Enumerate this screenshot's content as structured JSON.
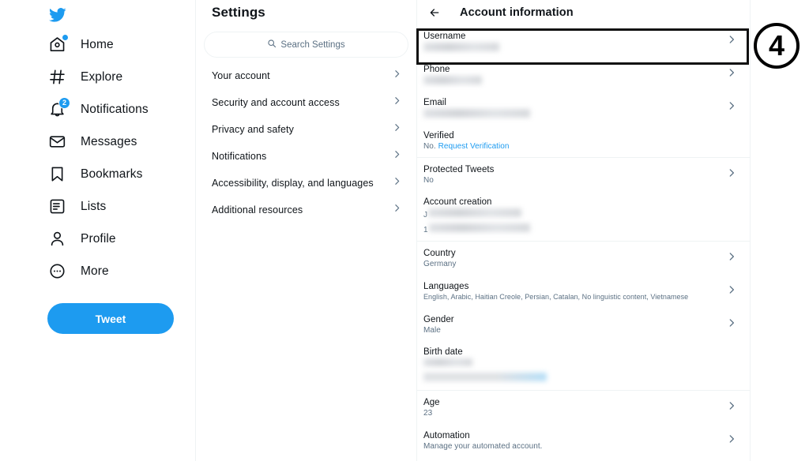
{
  "app": {
    "name": "Twitter",
    "logo_icon": "twitter-bird-icon"
  },
  "sidebar": {
    "items": [
      {
        "label": "Home",
        "icon": "home-icon",
        "dot": true,
        "badge": null
      },
      {
        "label": "Explore",
        "icon": "hashtag-icon",
        "dot": false,
        "badge": null
      },
      {
        "label": "Notifications",
        "icon": "bell-icon",
        "dot": false,
        "badge": "2"
      },
      {
        "label": "Messages",
        "icon": "envelope-icon",
        "dot": false,
        "badge": null
      },
      {
        "label": "Bookmarks",
        "icon": "bookmark-icon",
        "dot": false,
        "badge": null
      },
      {
        "label": "Lists",
        "icon": "list-icon",
        "dot": false,
        "badge": null
      },
      {
        "label": "Profile",
        "icon": "person-icon",
        "dot": false,
        "badge": null
      },
      {
        "label": "More",
        "icon": "more-circle-icon",
        "dot": false,
        "badge": null
      }
    ],
    "tweet_button": "Tweet"
  },
  "settings": {
    "title": "Settings",
    "search_placeholder": "Search Settings",
    "search_icon": "search-icon",
    "items": [
      {
        "label": "Your account"
      },
      {
        "label": "Security and account access"
      },
      {
        "label": "Privacy and safety"
      },
      {
        "label": "Notifications"
      },
      {
        "label": "Accessibility, display, and languages"
      },
      {
        "label": "Additional resources"
      }
    ]
  },
  "detail": {
    "back_icon": "back-arrow-icon",
    "title": "Account information",
    "rows": [
      {
        "key": "Username",
        "value": "",
        "redacted": "l1",
        "chevron": true,
        "highlighted": true
      },
      {
        "key": "Phone",
        "value": "",
        "redacted": "l2",
        "chevron": true
      },
      {
        "key": "Email",
        "value": "",
        "redacted": "l3",
        "chevron": true
      },
      {
        "key": "Verified",
        "value": "No.",
        "link": "Request Verification",
        "chevron": false
      },
      {
        "key": "Protected Tweets",
        "value": "No",
        "chevron": true
      },
      {
        "key": "Account creation",
        "value": "",
        "redacted": "two-line",
        "prefix1": "J",
        "prefix2": "1",
        "chevron": false
      },
      {
        "key": "Country",
        "value": "Germany",
        "chevron": true
      },
      {
        "key": "Languages",
        "value": "English, Arabic, Haitian Creole, Persian, Catalan, No linguistic content, Vietnamese",
        "chevron": true
      },
      {
        "key": "Gender",
        "value": "Male",
        "chevron": true
      },
      {
        "key": "Birth date",
        "value": "",
        "redacted": "two-line-blue",
        "chevron": false
      },
      {
        "key": "Age",
        "value": "23",
        "chevron": true
      },
      {
        "key": "Automation",
        "value": "Manage your automated account.",
        "chevron": true
      }
    ]
  },
  "annotation": {
    "marker": "4"
  },
  "colors": {
    "accent": "#1d9bf0",
    "text_primary": "#0f1419",
    "text_secondary": "#5b7083",
    "divider": "#eff3f4",
    "highlight_box": "#111111"
  }
}
